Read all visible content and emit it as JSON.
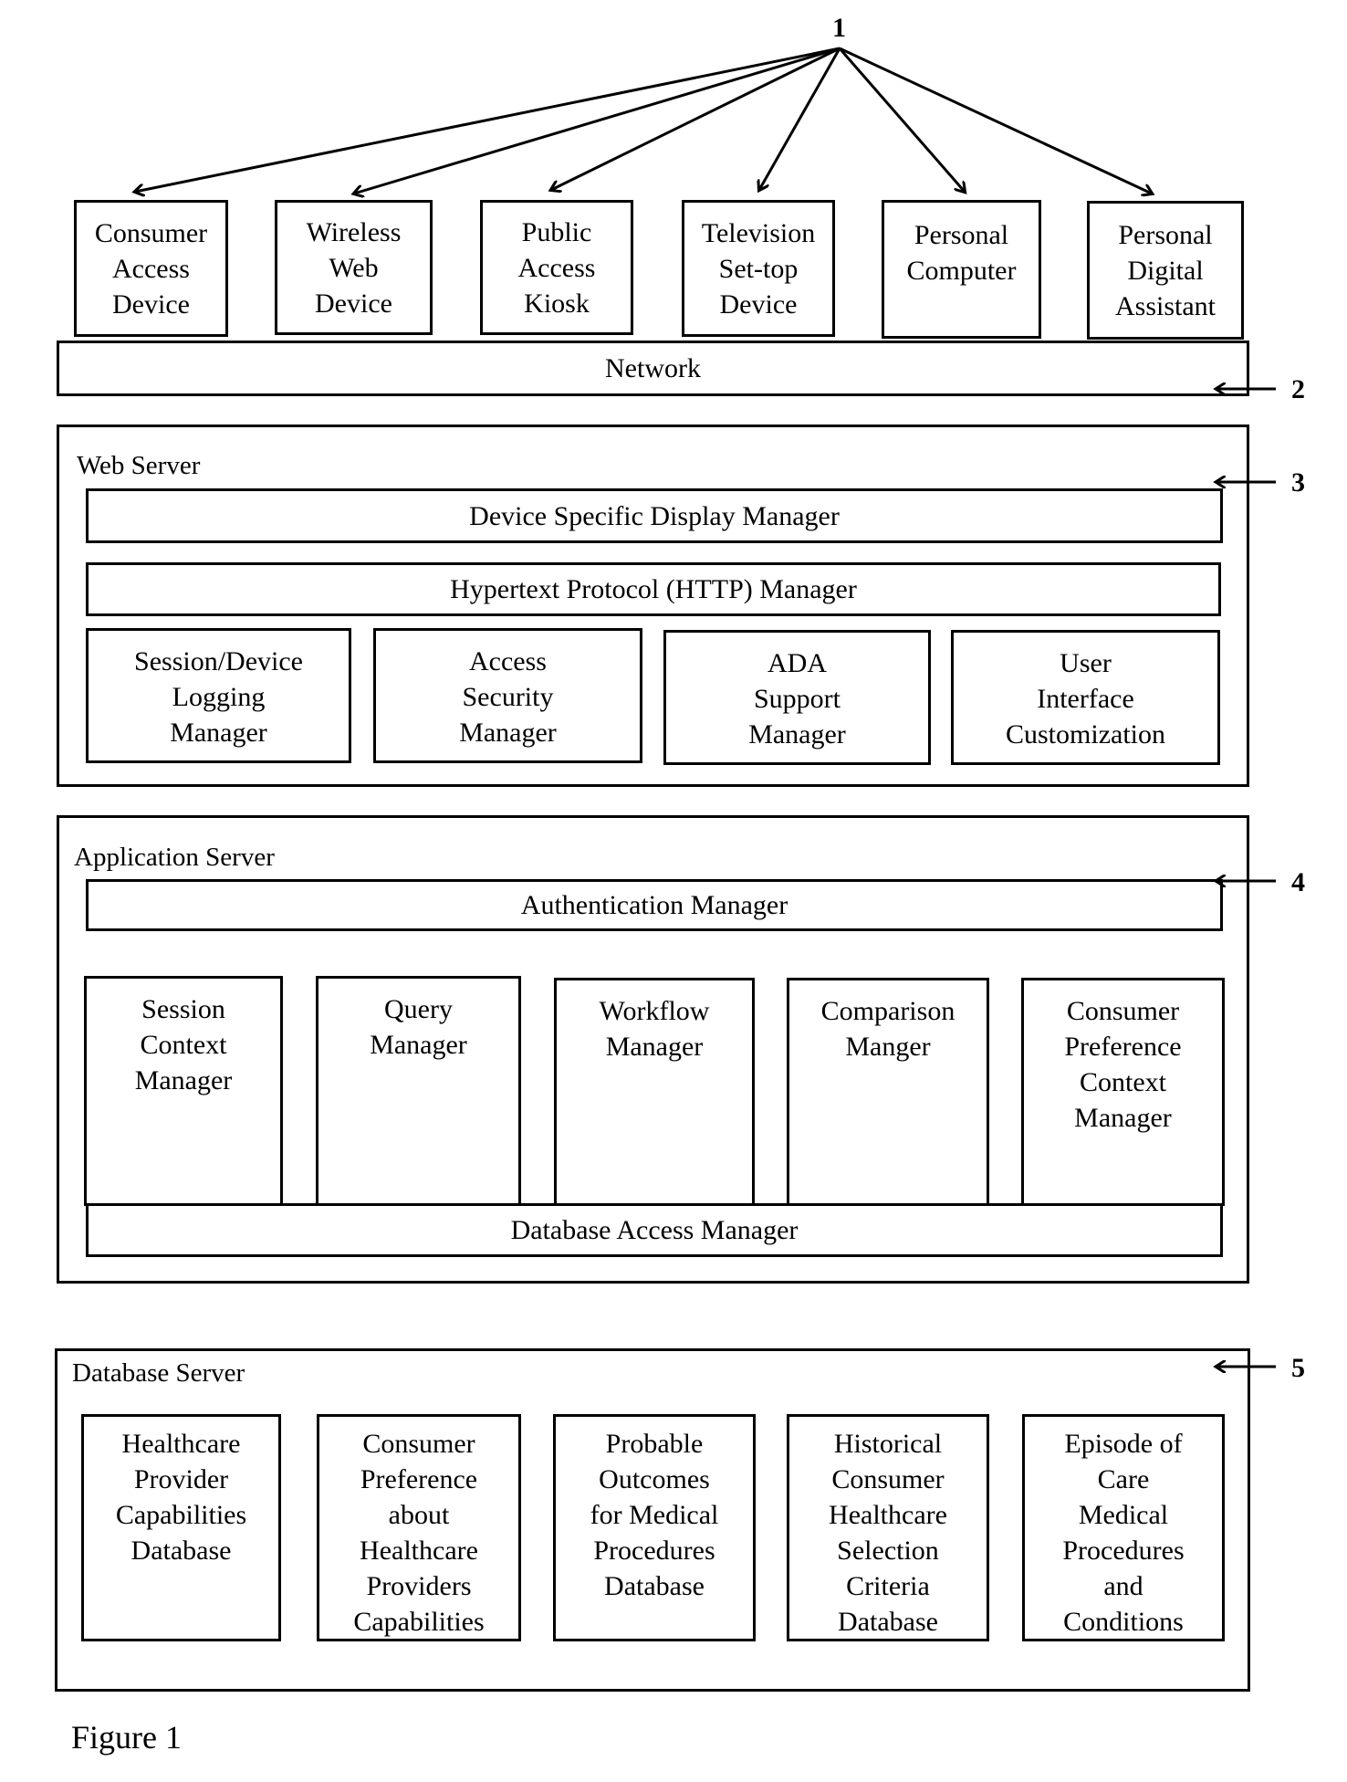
{
  "figure": {
    "caption": "Figure 1",
    "reference_numerals": {
      "devices": "1",
      "network": "2",
      "web_server": "3",
      "application_server": "4",
      "database_server": "5"
    }
  },
  "devices": [
    {
      "label": "Consumer\nAccess\nDevice"
    },
    {
      "label": "Wireless\nWeb\nDevice"
    },
    {
      "label": "Public\nAccess\nKiosk"
    },
    {
      "label": "Television\nSet-top\nDevice"
    },
    {
      "label": "Personal\nComputer"
    },
    {
      "label": "Personal\nDigital\nAssistant"
    }
  ],
  "network": {
    "label": "Network"
  },
  "web_server": {
    "title": "Web Server",
    "bars": [
      {
        "label": "Device Specific Display Manager"
      },
      {
        "label": "Hypertext Protocol (HTTP) Manager"
      }
    ],
    "modules": [
      {
        "label": "Session/Device\nLogging\nManager"
      },
      {
        "label": "Access\nSecurity\nManager"
      },
      {
        "label": "ADA\nSupport\nManager"
      },
      {
        "label": "User\nInterface\nCustomization"
      }
    ]
  },
  "application_server": {
    "title": "Application Server",
    "top_bar": {
      "label": "Authentication Manager"
    },
    "modules": [
      {
        "label": "Session\nContext\nManager"
      },
      {
        "label": "Query\nManager"
      },
      {
        "label": "Workflow\nManager"
      },
      {
        "label": "Comparison\nManger"
      },
      {
        "label": "Consumer\nPreference\nContext\nManager"
      }
    ],
    "bottom_bar": {
      "label": "Database Access Manager"
    }
  },
  "database_server": {
    "title": "Database Server",
    "databases": [
      {
        "label": "Healthcare\nProvider\nCapabilities\nDatabase"
      },
      {
        "label": "Consumer\nPreference\nabout\nHealthcare\nProviders\nCapabilities"
      },
      {
        "label": "Probable\nOutcomes\nfor Medical\nProcedures\nDatabase"
      },
      {
        "label": "Historical\nConsumer\nHealthcare\nSelection\nCriteria\nDatabase"
      },
      {
        "label": "Episode of\nCare\nMedical\nProcedures\nand\nConditions"
      }
    ]
  }
}
